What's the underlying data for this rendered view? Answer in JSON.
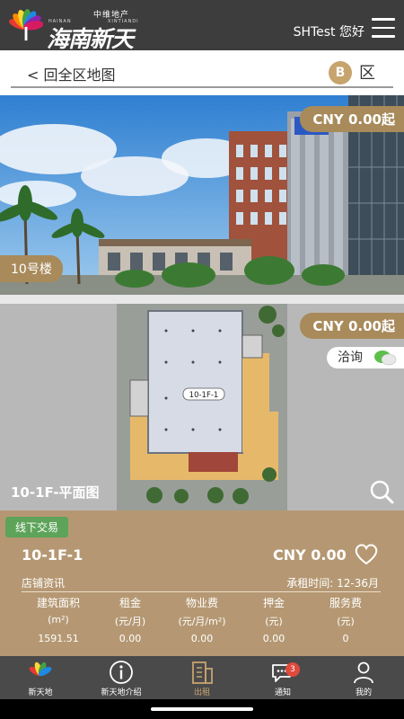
{
  "header": {
    "logo_top": "中维地产",
    "logo_en_left": "HAINAN",
    "logo_en_right": "XINTIANDI",
    "logo_cn": "海南新天地",
    "user": "SHTest 您好"
  },
  "nav": {
    "back_label": "< 回全区地图",
    "zone_letter": "B",
    "zone_suffix": "区"
  },
  "building": {
    "price": "CNY 0.00起",
    "name": "10号楼"
  },
  "floor_plan": {
    "price": "CNY 0.00起",
    "consult": "洽询",
    "plan_label": "10-1F-1",
    "title": "10-1F-平面图"
  },
  "unit": {
    "badge": "线下交易",
    "name": "10-1F-1",
    "price": "CNY 0.00",
    "info_label": "店铺资讯",
    "lease_time": "承租时间: 12-36月",
    "columns": [
      "建筑面积",
      "租金",
      "物业费",
      "押金",
      "服务费"
    ],
    "units": [
      "(m²)",
      "(元/月)",
      "(元/月/m²)",
      "(元)",
      "(元)"
    ],
    "values": [
      "1591.51",
      "0.00",
      "0.00",
      "0.00",
      "0"
    ]
  },
  "tabs": [
    {
      "label": "新天地",
      "icon": "flower-logo-icon"
    },
    {
      "label": "新天地介绍",
      "icon": "info-icon"
    },
    {
      "label": "出租",
      "icon": "building-icon"
    },
    {
      "label": "通知",
      "icon": "chat-icon"
    },
    {
      "label": "我的",
      "icon": "person-icon"
    }
  ],
  "notification_count": "3",
  "colors": {
    "header_bg": "#3d3d3d",
    "gold": "#a88a5b",
    "card_bg": "#b59873",
    "badge_green": "#5ea35a",
    "tab_active": "#c7a46d"
  }
}
